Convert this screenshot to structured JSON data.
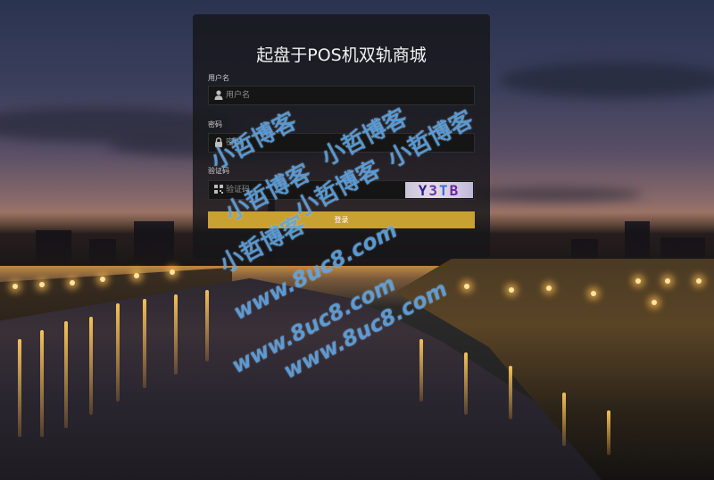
{
  "login": {
    "title": "起盘于POS机双轨商城",
    "username_label": "用户名",
    "username_placeholder": "用户名",
    "password_label": "密码",
    "password_placeholder": "密码",
    "captcha_label": "验证码",
    "captcha_placeholder": "验证码",
    "captcha_chars": [
      "Y",
      "3",
      "T",
      "B"
    ],
    "submit_label": "登录"
  },
  "watermark": {
    "name": "小哲博客",
    "url": "www.8uc8.com"
  },
  "colors": {
    "panel_bg": "#16161a",
    "button": "#c9a132",
    "watermark": "#58a2e4"
  },
  "icons": {
    "username": "user-icon",
    "password": "lock-icon",
    "captcha": "qrcode-icon"
  }
}
